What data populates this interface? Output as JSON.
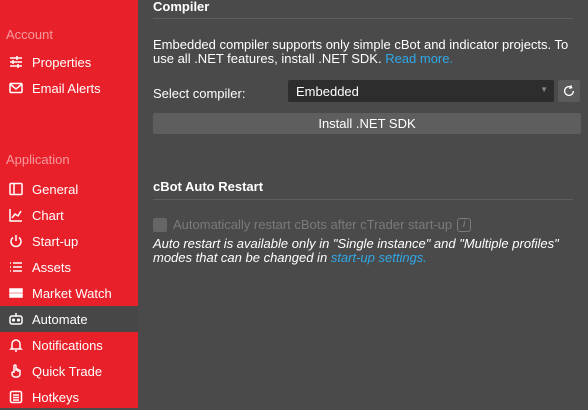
{
  "sidebar": {
    "account_heading": "Account",
    "application_heading": "Application",
    "items": [
      {
        "label": "Properties",
        "icon": "sliders-icon"
      },
      {
        "label": "Email Alerts",
        "icon": "envelope-icon"
      },
      {
        "label": "General",
        "icon": "window-icon"
      },
      {
        "label": "Chart",
        "icon": "chart-icon"
      },
      {
        "label": "Start-up",
        "icon": "power-icon"
      },
      {
        "label": "Assets",
        "icon": "list-icon"
      },
      {
        "label": "Market Watch",
        "icon": "market-watch-icon"
      },
      {
        "label": "Automate",
        "icon": "robot-icon"
      },
      {
        "label": "Notifications",
        "icon": "bell-icon"
      },
      {
        "label": "Quick Trade",
        "icon": "hand-pointer-icon"
      },
      {
        "label": "Hotkeys",
        "icon": "keyboard-icon"
      }
    ],
    "active": "Automate"
  },
  "compiler": {
    "heading": "Compiler",
    "description": "Embedded compiler supports only simple cBot and indicator projects. To use all .NET features, install .NET SDK.",
    "read_more": "Read more.",
    "select_label": "Select compiler:",
    "selected_value": "Embedded",
    "install_button": "Install .NET SDK"
  },
  "restart": {
    "heading": "cBot Auto Restart",
    "checkbox_label": "Automatically restart cBots after cTrader start-up",
    "checked": false,
    "note": "Auto restart is available only in \"Single instance\" and \"Multiple profiles\" modes that can be changed in",
    "note_link": "start-up settings."
  },
  "colors": {
    "sidebar_bg": "#e8202a",
    "main_bg": "#4a4a4a",
    "active_item_bg": "#474747",
    "link": "#2fa8e8"
  }
}
